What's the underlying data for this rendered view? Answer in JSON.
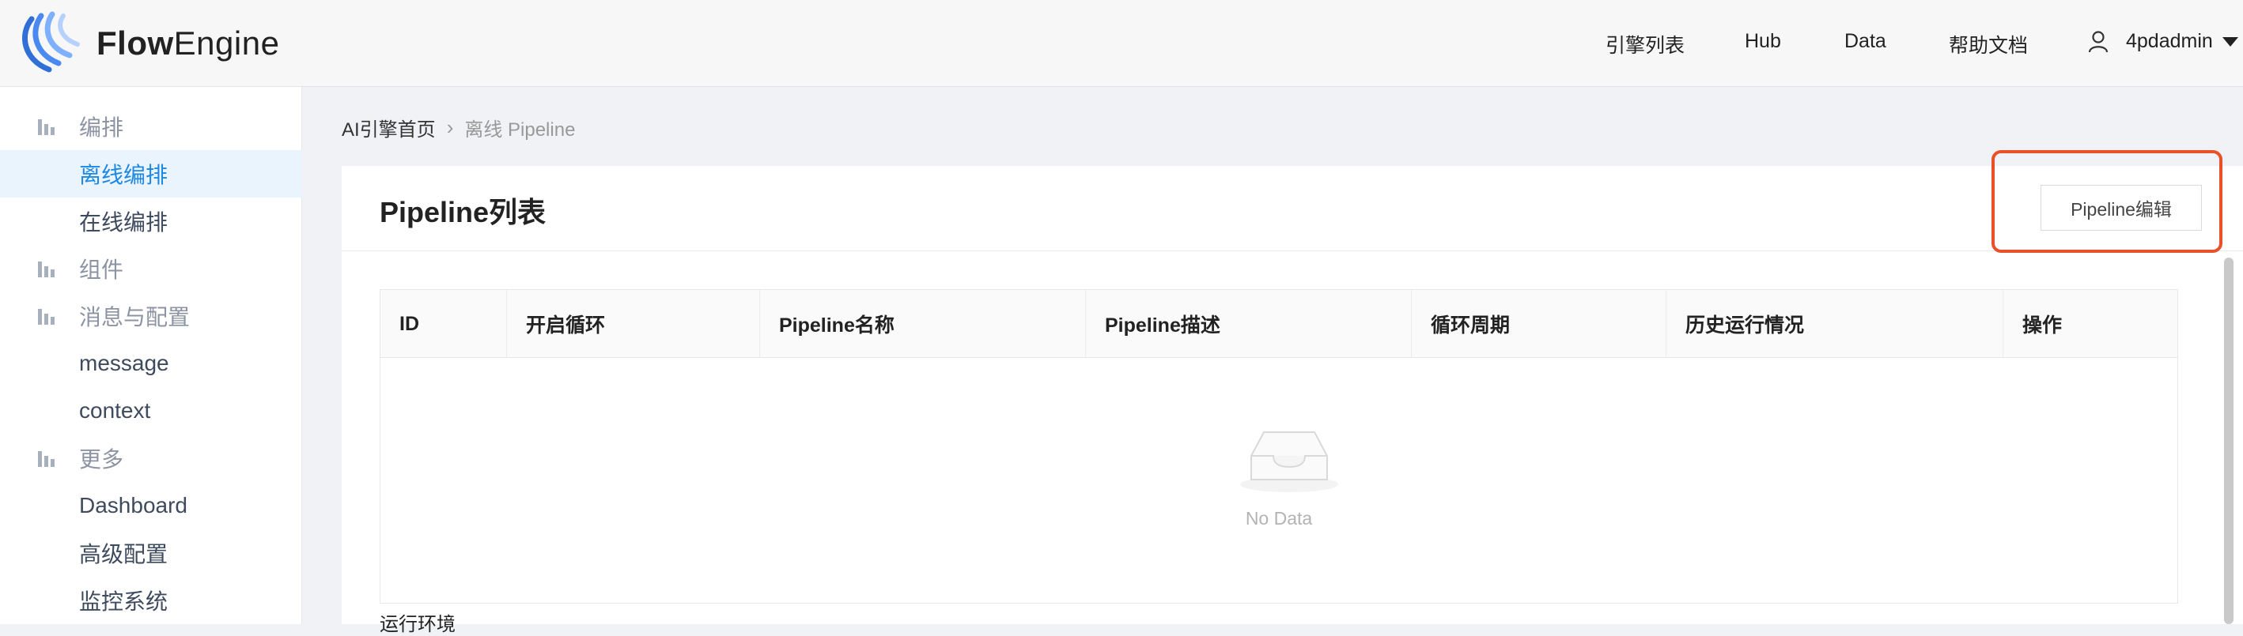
{
  "app": {
    "logo_text_a": "Flow",
    "logo_text_b": "Engine"
  },
  "nav": {
    "items": [
      "引擎列表",
      "Hub",
      "Data",
      "帮助文档"
    ],
    "username": "4pdadmin"
  },
  "sidebar": {
    "groups": [
      {
        "label": "编排",
        "items": [
          "离线编排",
          "在线编排"
        ]
      },
      {
        "label": "组件",
        "items": []
      },
      {
        "label": "消息与配置",
        "items": [
          "message",
          "context"
        ]
      },
      {
        "label": "更多",
        "items": [
          "Dashboard",
          "高级配置",
          "监控系统"
        ]
      }
    ],
    "active_item": "离线编排"
  },
  "breadcrumb": {
    "home": "AI引擎首页",
    "current": "离线 Pipeline"
  },
  "card": {
    "title": "Pipeline列表",
    "edit_button": "Pipeline编辑"
  },
  "table": {
    "columns": [
      "ID",
      "开启循环",
      "Pipeline名称",
      "Pipeline描述",
      "循环周期",
      "历史运行情况",
      "操作"
    ],
    "rows": [],
    "empty_text": "No Data"
  },
  "section_label": "运行环境",
  "colors": {
    "accent": "#1e88e5",
    "highlight": "#e8512a"
  }
}
